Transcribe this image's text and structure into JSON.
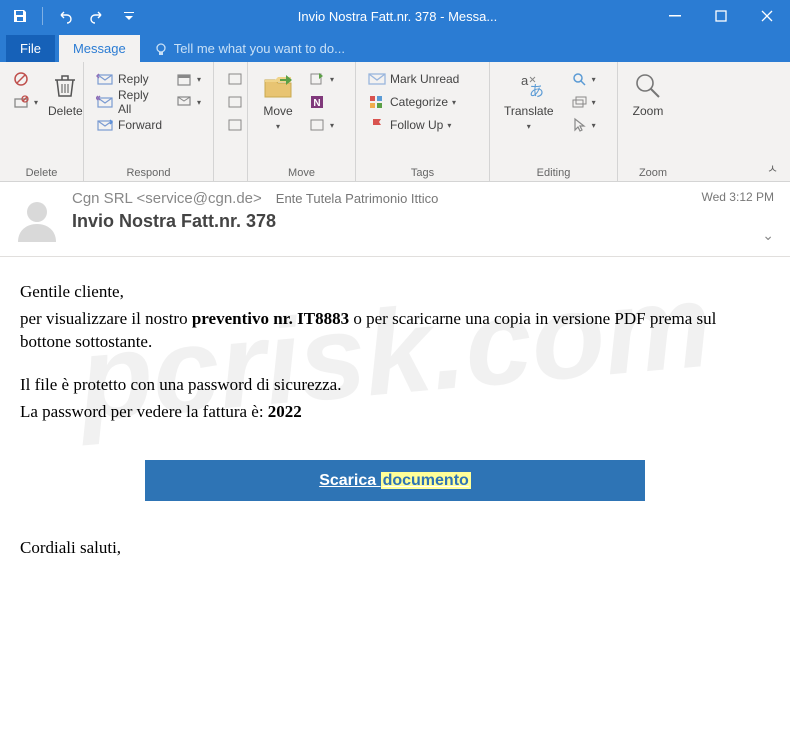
{
  "titlebar": {
    "title": "Invio Nostra Fatt.nr. 378 - Messa..."
  },
  "tabs": {
    "file": "File",
    "message": "Message",
    "tell_me": "Tell me what you want to do..."
  },
  "ribbon": {
    "delete_group": {
      "big": "Delete",
      "label": "Delete"
    },
    "respond_group": {
      "reply": "Reply",
      "reply_all": "Reply All",
      "forward": "Forward",
      "label": "Respond"
    },
    "move_group": {
      "big": "Move",
      "label": "Move"
    },
    "tags_group": {
      "mark_unread": "Mark Unread",
      "categorize": "Categorize",
      "follow_up": "Follow Up",
      "label": "Tags"
    },
    "editing_group": {
      "big": "Translate",
      "label": "Editing"
    },
    "zoom_group": {
      "big": "Zoom",
      "label": "Zoom"
    }
  },
  "header": {
    "from": "Cgn SRL <service@cgn.de>",
    "to": "Ente Tutela Patrimonio Ittico",
    "subject": "Invio Nostra Fatt.nr. 378",
    "date": "Wed 3:12 PM"
  },
  "body": {
    "greeting": "Gentile cliente,",
    "p1a": "per visualizzare il nostro ",
    "p1b": "preventivo nr. IT8883",
    "p1c": " o per scaricarne una copia in versione PDF prema sul bottone sottostante.",
    "p2": "Il file è protetto con una password di sicurezza.",
    "p3a": "La password per vedere la fattura è: ",
    "p3b": "2022",
    "btn_a": "Scarica ",
    "btn_b": "documento",
    "signoff": "Cordiali saluti,"
  }
}
